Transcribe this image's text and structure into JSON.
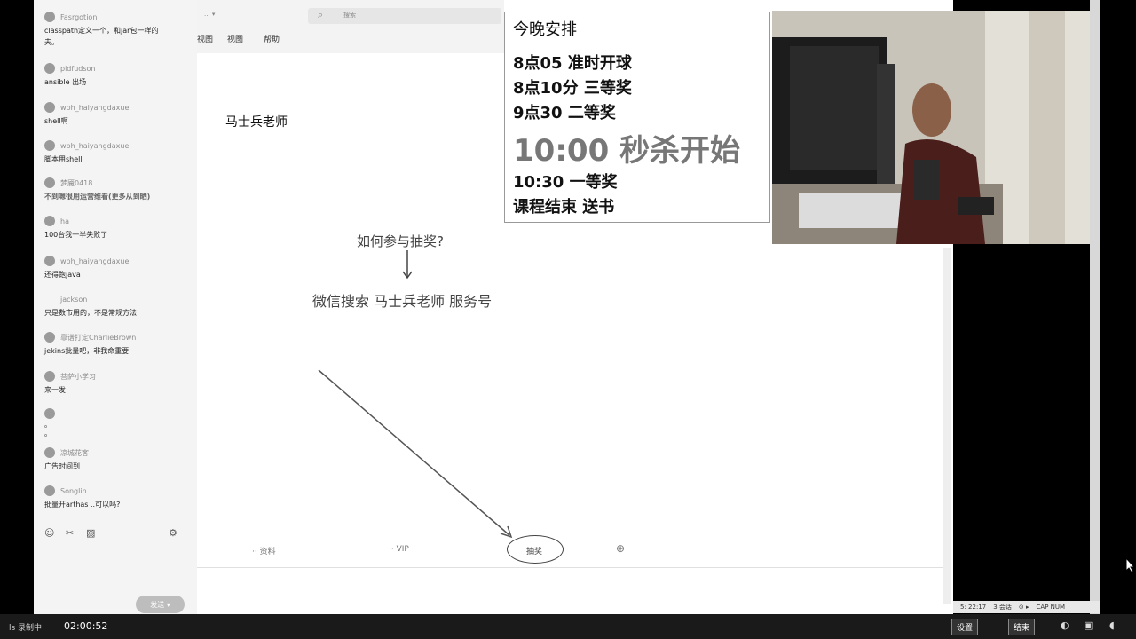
{
  "chat": {
    "messages": [
      {
        "user": "Fasrgotion",
        "text": "classpath定义一个，和jar包一样的",
        "text2": "夫。"
      },
      {
        "user": "pidfudson",
        "text": "ansible 出场"
      },
      {
        "user": "wph_haiyangdaxue",
        "text": "shell啊"
      },
      {
        "user": "wph_haiyangdaxue",
        "text": "脚本用shell"
      },
      {
        "user": "梦魇0418",
        "text": "不到嗯很用运营维看(更多从到晒)"
      },
      {
        "user": "ha",
        "text": "100台我一半失败了"
      },
      {
        "user": "wph_haiyangdaxue",
        "text": "还得跑java"
      },
      {
        "user": "jackson",
        "text": "只是数市用的，不是常规方法"
      },
      {
        "user": "靠谱打定CharlieBrown",
        "text": "jekins批量吧，非我命重要"
      },
      {
        "user": "菩萨小学习",
        "text": "来一发"
      },
      {
        "user": "",
        "text": "。"
      },
      {
        "user": "",
        "text": "。"
      },
      {
        "user": "凉城花客",
        "text": "广告时间到"
      },
      {
        "user": "Songlin",
        "text": "批量开arthas ..可以吗?"
      }
    ],
    "send_label": "发送"
  },
  "browser": {
    "tab_label": "... ▾",
    "search_placeholder": "搜索",
    "menu": [
      "视图",
      "视图",
      "帮助"
    ]
  },
  "content": {
    "teacher_name": "马士兵老师",
    "how_join": "如何参与抽奖?",
    "wechat_search": "微信搜索 马士兵老师 服务号",
    "bottom_tabs": [
      "资料",
      "VIP",
      "抽奖"
    ]
  },
  "schedule": {
    "title": "今晚安排",
    "items": [
      "8点05 准时开球",
      "8点10分 三等奖",
      "9点30 二等奖",
      "10:00 秒杀开始",
      "10:30 一等奖",
      "课程结束 送书"
    ]
  },
  "status": {
    "left": "5: 22:17",
    "mid": "3 会话",
    "caps": "CAP NUM"
  },
  "taskbar": {
    "label": "ls 录制中",
    "time": "02:00:52",
    "btn1": "设置",
    "btn2": "结束"
  }
}
